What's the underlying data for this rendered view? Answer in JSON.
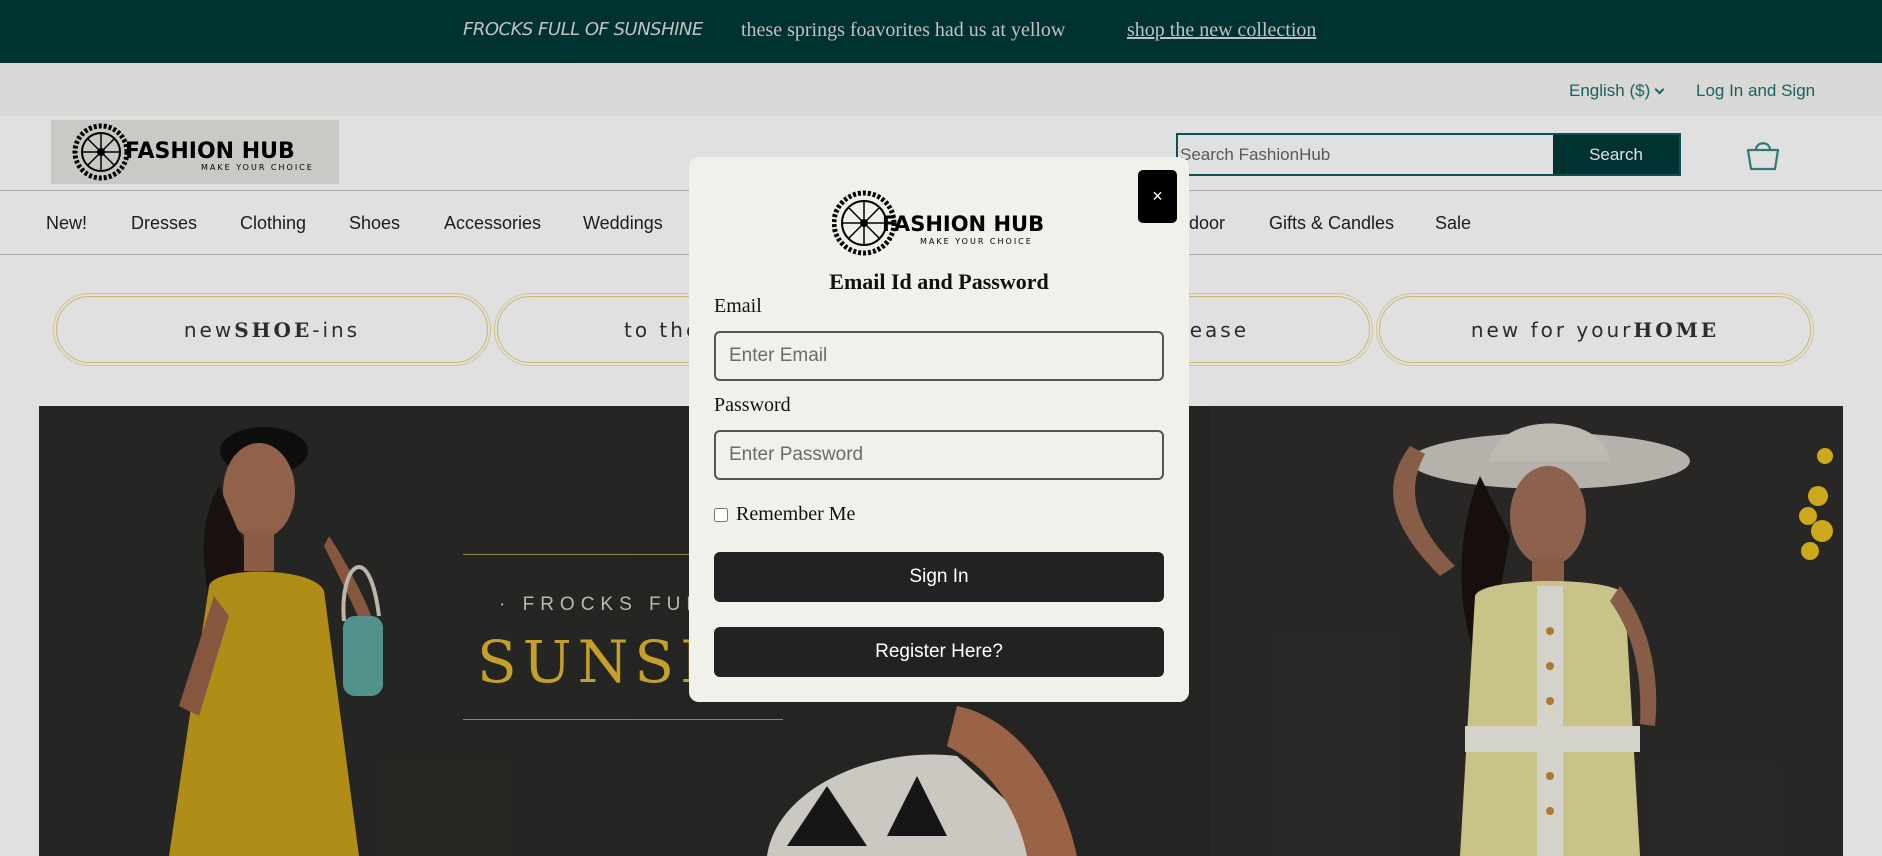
{
  "promo": {
    "title": "FROCKS FULL OF SUNSHINE",
    "subtitle": "these springs foavorites had us at yellow",
    "link": "shop the new collection"
  },
  "utility": {
    "language": "English ($)",
    "login": "Log In and Sign"
  },
  "header": {
    "logo_text": "FASHION HUB",
    "logo_tagline": "MAKE YOUR CHOICE",
    "search_placeholder": "Search FashionHub",
    "search_button": "Search",
    "cart_icon": "basket-icon"
  },
  "nav": {
    "items": [
      "New!",
      "Dresses",
      "Clothing",
      "Shoes",
      "Accessories",
      "Weddings",
      "door",
      "Gifts & Candles",
      "Sale"
    ]
  },
  "categories": {
    "shoe": {
      "pre": "new ",
      "bold": "SHOE",
      "post": "-ins"
    },
    "second": "to the",
    "third": "lease",
    "home": {
      "pre": "new for your ",
      "bold": "HOME"
    }
  },
  "hero": {
    "kicker": "· FROCKS FULL",
    "headline": "SUNSH"
  },
  "modal": {
    "close_label": "×",
    "logo_text": "FASHION HUB",
    "logo_tagline": "MAKE YOUR CHOICE",
    "title": "Email Id and Password",
    "email_label": "Email",
    "email_placeholder": "Enter Email",
    "password_label": "Password",
    "password_placeholder": "Enter Password",
    "remember_label": "Remember Me",
    "signin_button": "Sign In",
    "register_button": "Register Here?"
  },
  "colors": {
    "brand_teal": "#003a3a",
    "link_teal": "#1e6f6f",
    "modal_bg": "#f1f0eb",
    "button_dark": "#222222",
    "hero_gold": "#e0b632"
  }
}
